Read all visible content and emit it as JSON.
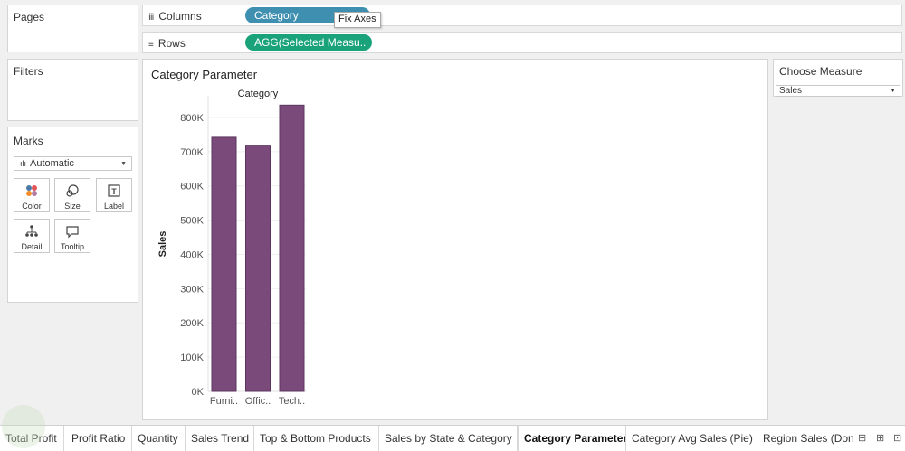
{
  "pages": {
    "title": "Pages"
  },
  "filters": {
    "title": "Filters"
  },
  "marks": {
    "title": "Marks",
    "type": "Automatic",
    "buttons": [
      {
        "label": "Color",
        "icon": "color-dots-icon"
      },
      {
        "label": "Size",
        "icon": "size-circles-icon"
      },
      {
        "label": "Label",
        "icon": "label-t-icon"
      },
      {
        "label": "Detail",
        "icon": "detail-dots-icon"
      },
      {
        "label": "Tooltip",
        "icon": "tooltip-bubble-icon"
      }
    ]
  },
  "shelves": {
    "columns": {
      "label": "Columns",
      "pill": "Category"
    },
    "rows": {
      "label": "Rows",
      "pill": "AGG(Selected Measu.."
    },
    "tooltip": "Fix Axes"
  },
  "view": {
    "title": "Category Parameter"
  },
  "parameter": {
    "title": "Choose Measure",
    "value": "Sales"
  },
  "colors": {
    "bar": "#7a4a7a",
    "bar_edge": "#5e3560",
    "columns_pill": "#3e8fb0",
    "rows_pill": "#1aa37a"
  },
  "chart_data": {
    "type": "bar",
    "header": "Category",
    "ylabel": "Sales",
    "categories": [
      "Furni..",
      "Offic..",
      "Tech.."
    ],
    "values": [
      742000,
      719000,
      836000
    ],
    "yticks": [
      "0K",
      "100K",
      "200K",
      "300K",
      "400K",
      "500K",
      "600K",
      "700K",
      "800K"
    ],
    "ylim": [
      0,
      850000
    ],
    "grid": true
  },
  "tabs": [
    "Total Profit",
    "Profit Ratio",
    "Quantity",
    "Sales Trend",
    "Top & Bottom Products",
    "Sales by State & Category",
    "Category Parameter",
    "Category Avg Sales (Pie)",
    "Region Sales (Donu"
  ],
  "active_tab": "Category Parameter"
}
